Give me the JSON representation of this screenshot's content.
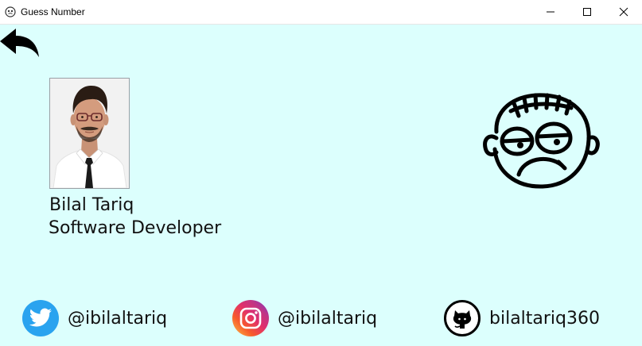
{
  "window": {
    "title": "Guess Number"
  },
  "profile": {
    "name": "Bilal Tariq",
    "role": "Software Developer"
  },
  "social": [
    {
      "platform": "twitter",
      "handle": "@ibilaltariq",
      "icon": "twitter-icon",
      "color": "#2aa3ef"
    },
    {
      "platform": "instagram",
      "handle": "@ibilaltariq",
      "icon": "instagram-icon",
      "color": "#e1306c"
    },
    {
      "platform": "github",
      "handle": "bilaltariq360",
      "icon": "github-icon",
      "color": "#000000"
    }
  ],
  "colors": {
    "background": "#dcfffd",
    "text": "#111111"
  }
}
